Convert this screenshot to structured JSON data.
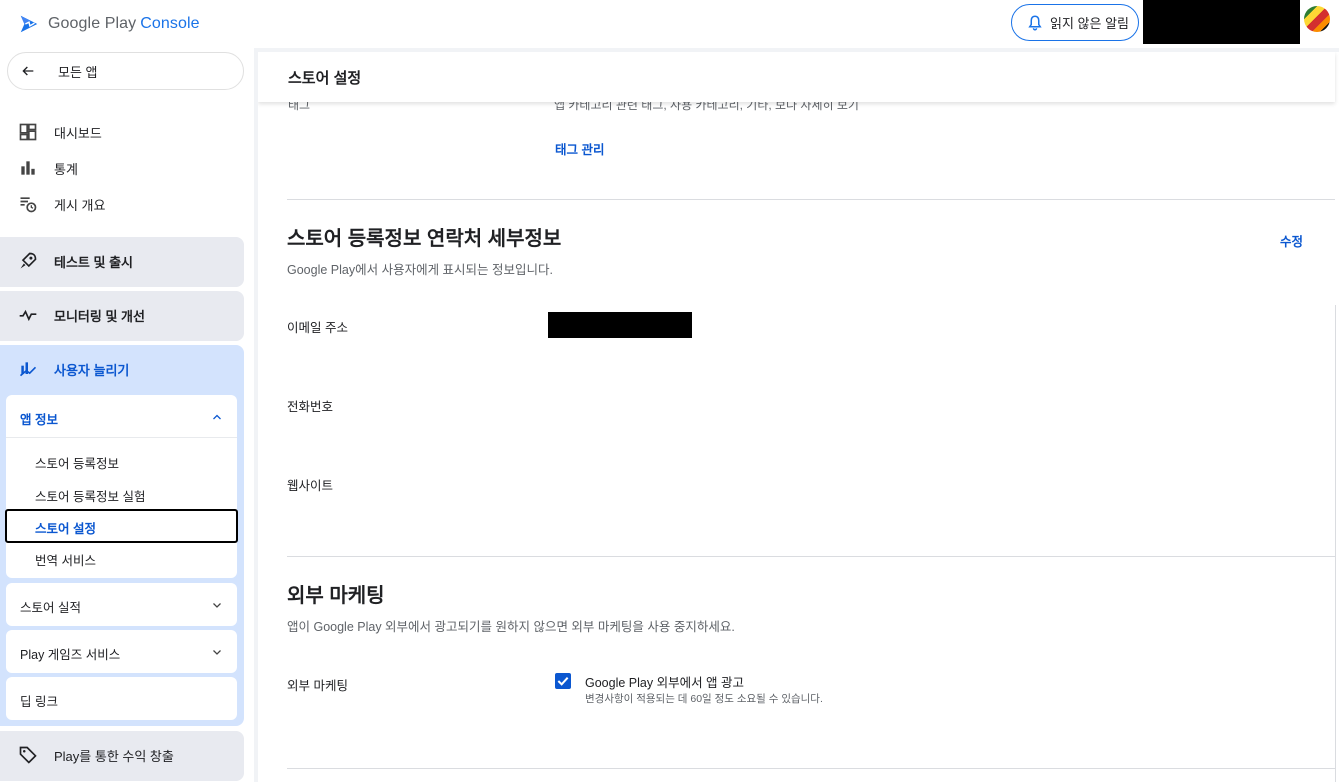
{
  "topbar": {
    "logo_text": "Google Play",
    "logo_accent": "Console",
    "notifications_label": "읽지 않은 알림"
  },
  "sidebar": {
    "back_label": "모든 앱",
    "items": [
      {
        "label": "대시보드",
        "icon": "dashboard-icon"
      },
      {
        "label": "통계",
        "icon": "bar-chart-icon"
      },
      {
        "label": "게시 개요",
        "icon": "publishing-overview-icon"
      }
    ],
    "groups": [
      {
        "label": "테스트 및 출시",
        "icon": "rocket-icon"
      },
      {
        "label": "모니터링 및 개선",
        "icon": "pulse-icon"
      },
      {
        "label": "사용자 늘리기",
        "icon": "grow-users-icon"
      }
    ],
    "app_info": {
      "label": "앱 정보",
      "items": [
        "스토어 등록정보",
        "스토어 등록정보 실험",
        "스토어 설정",
        "번역 서비스"
      ]
    },
    "sub_sections": [
      "스토어 실적",
      "Play 게임즈 서비스",
      "딥 링크"
    ],
    "monetize_label": "Play를 통한 수익 창출"
  },
  "main": {
    "page_title": "스토어 설정",
    "peek_label": "태그",
    "peek_value": "앱 카테고리 관련 태그, 사용 카테고리, 기타, 보다 자세히 보기",
    "manage_tags_link": "태그 관리",
    "contact_section": {
      "title": "스토어 등록정보 연락처 세부정보",
      "description": "Google Play에서 사용자에게 표시되는 정보입니다.",
      "edit_link": "수정",
      "fields": [
        "이메일 주소",
        "전화번호",
        "웹사이트"
      ]
    },
    "external_marketing": {
      "title": "외부 마케팅",
      "description": "앱이 Google Play 외부에서 광고되기를 원하지 않으면 외부 마케팅을 사용 중지하세요.",
      "field_label": "외부 마케팅",
      "checkbox_label": "Google Play 외부에서 앱 광고",
      "checkbox_checked": true,
      "checkbox_help": "변경사항이 적용되는 데 60일 정도 소요될 수 있습니다."
    }
  },
  "colors": {
    "accent": "#0b57d0",
    "sidebar_group_bg": "#e8eaf0",
    "active_group_bg": "#d3e3fd"
  }
}
